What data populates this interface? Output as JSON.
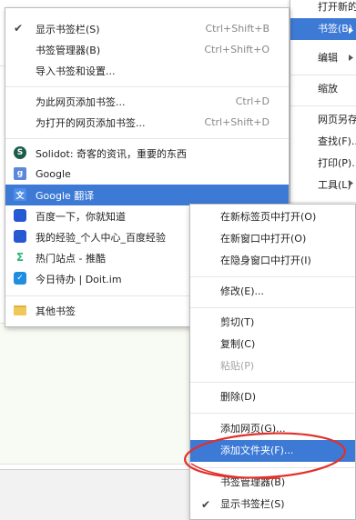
{
  "main_menu": {
    "items": [
      {
        "label": "打开新的",
        "active": false
      },
      {
        "label": "书签(B)",
        "active": true
      },
      {
        "label": "编辑",
        "active": false
      },
      {
        "label": "缩放",
        "active": false
      },
      {
        "label": "网页另存",
        "active": false
      },
      {
        "label": "查找(F)...",
        "active": false
      },
      {
        "label": "打印(P)...",
        "active": false
      },
      {
        "label": "工具(L)",
        "active": false
      }
    ]
  },
  "bookmarks_menu": {
    "show_bar": {
      "label": "显示书签栏(S)",
      "shortcut": "Ctrl+Shift+B",
      "checked": true
    },
    "manager": {
      "label": "书签管理器(B)",
      "shortcut": "Ctrl+Shift+O"
    },
    "import": {
      "label": "导入书签和设置..."
    },
    "add_page": {
      "label": "为此网页添加书签...",
      "shortcut": "Ctrl+D"
    },
    "add_open_pages": {
      "label": "为打开的网页添加书签...",
      "shortcut": "Ctrl+Shift+D"
    },
    "bookmarks": [
      {
        "label": "Solidot: 奇客的资讯，重要的东西",
        "icon": "solidot-icon"
      },
      {
        "label": "Google",
        "icon": "google-icon"
      },
      {
        "label": "Google 翻译",
        "icon": "google-translate-icon"
      },
      {
        "label": "百度一下，你就知道",
        "icon": "baidu-icon"
      },
      {
        "label": "我的经验_个人中心_百度经验",
        "icon": "baidu-icon"
      },
      {
        "label": "热门站点 - 推酷",
        "icon": "tuicool-icon"
      },
      {
        "label": "今日待办 | Doit.im",
        "icon": "doit-icon"
      }
    ],
    "other": {
      "label": "其他书签",
      "icon": "folder-icon"
    }
  },
  "context_menu": {
    "open_new_tab": "在新标签页中打开(O)",
    "open_new_window": "在新窗口中打开(O)",
    "open_incognito": "在隐身窗口中打开(I)",
    "edit": "修改(E)...",
    "cut": "剪切(T)",
    "copy": "复制(C)",
    "paste": "粘贴(P)",
    "delete": "删除(D)",
    "add_page": "添加网页(G)...",
    "add_folder": "添加文件夹(F)...",
    "manager": "书签管理器(B)",
    "show_bar": "显示书签栏(S)"
  },
  "colors": {
    "highlight": "#3d7ad6",
    "annotation": "#e0302a"
  }
}
